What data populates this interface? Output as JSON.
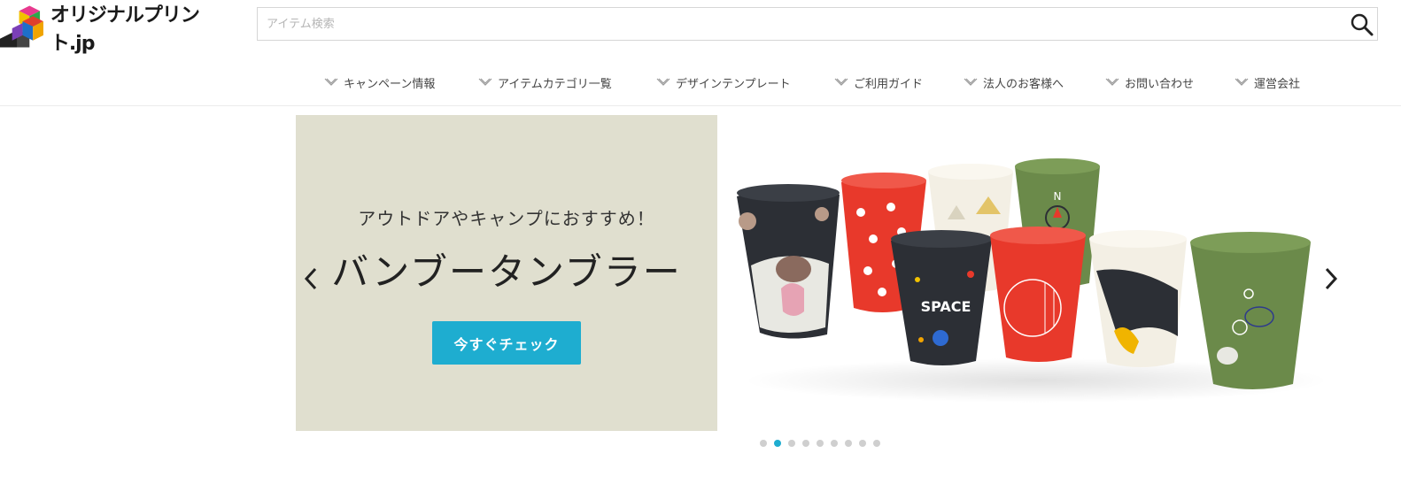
{
  "header": {
    "logo_text": "オリジナルプリント.jp",
    "search": {
      "placeholder": "アイテム検索",
      "value": ""
    }
  },
  "nav": {
    "items": [
      {
        "label": "キャンペーン情報",
        "icon": "chevron-down-double-icon"
      },
      {
        "label": "アイテムカテゴリ一覧",
        "icon": "chevron-down-double-icon"
      },
      {
        "label": "デザインテンプレート",
        "icon": "chevron-down-double-icon"
      },
      {
        "label": "ご利用ガイド",
        "icon": "chevron-down-double-icon"
      },
      {
        "label": "法人のお客様へ",
        "icon": "chevron-down-double-icon"
      },
      {
        "label": "お問い合わせ",
        "icon": "chevron-down-double-icon"
      },
      {
        "label": "運営会社",
        "icon": "chevron-down-double-icon"
      }
    ]
  },
  "slider": {
    "subtitle": "アウトドアやキャンプにおすすめ！",
    "headline": "バンブータンブラー",
    "cta_label": "今すぐチェック",
    "prev_icon": "chevron-left-icon",
    "next_icon": "chevron-right-icon",
    "dot_count": 9,
    "active_dot": 2,
    "cup_texts": [
      "SPACE",
      "N"
    ]
  },
  "colors": {
    "accent": "#1eadd0",
    "slide_bg": "#e0dfcf",
    "cup_red": "#e8392b",
    "cup_green": "#6b8a4a",
    "cup_dark": "#2c2f35",
    "cup_cream": "#f3efe4"
  }
}
